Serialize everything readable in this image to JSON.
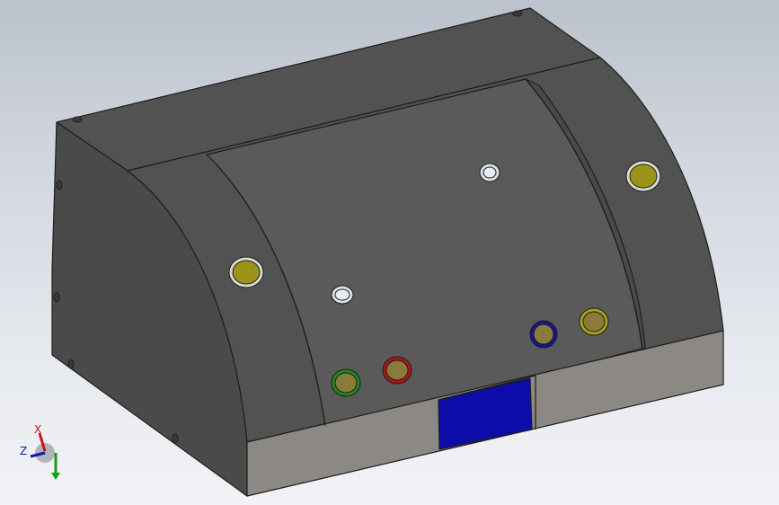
{
  "viewport": {
    "background_top": "#bcc2cd",
    "background_bottom": "#f2f3f6"
  },
  "model": {
    "body_color": "#525252",
    "panel_color": "#5a5a5a",
    "side_color": "#4a4a4a",
    "base_color": "#8c8884",
    "edge_color": "#1e1e1e",
    "display_window_color": "#0c0ca8",
    "buttons": [
      {
        "name": "top-hole-button",
        "ring": "#d8dde6",
        "fill": "#e8edf4"
      },
      {
        "name": "center-hole-button",
        "ring": "#d8dde6",
        "fill": "#e8edf4"
      },
      {
        "name": "left-yellow-button",
        "ring": "#d9d9d0",
        "fill": "#9b9418"
      },
      {
        "name": "right-yellow-button",
        "ring": "#d9d9d0",
        "fill": "#9b9418"
      },
      {
        "name": "green-button",
        "ring": "#1c8a1c",
        "fill": "#8b7b3a"
      },
      {
        "name": "red-button",
        "ring": "#b01414",
        "fill": "#8b7b3a"
      },
      {
        "name": "blue-button",
        "ring": "#141496",
        "fill": "#8b7b3a"
      },
      {
        "name": "yellow-small-button",
        "ring": "#a8a020",
        "fill": "#8b7b3a"
      }
    ]
  },
  "triad": {
    "x_label": "X",
    "z_label": "Z",
    "x_color": "#c81414",
    "y_color": "#14a014",
    "z_color": "#1414b4"
  }
}
